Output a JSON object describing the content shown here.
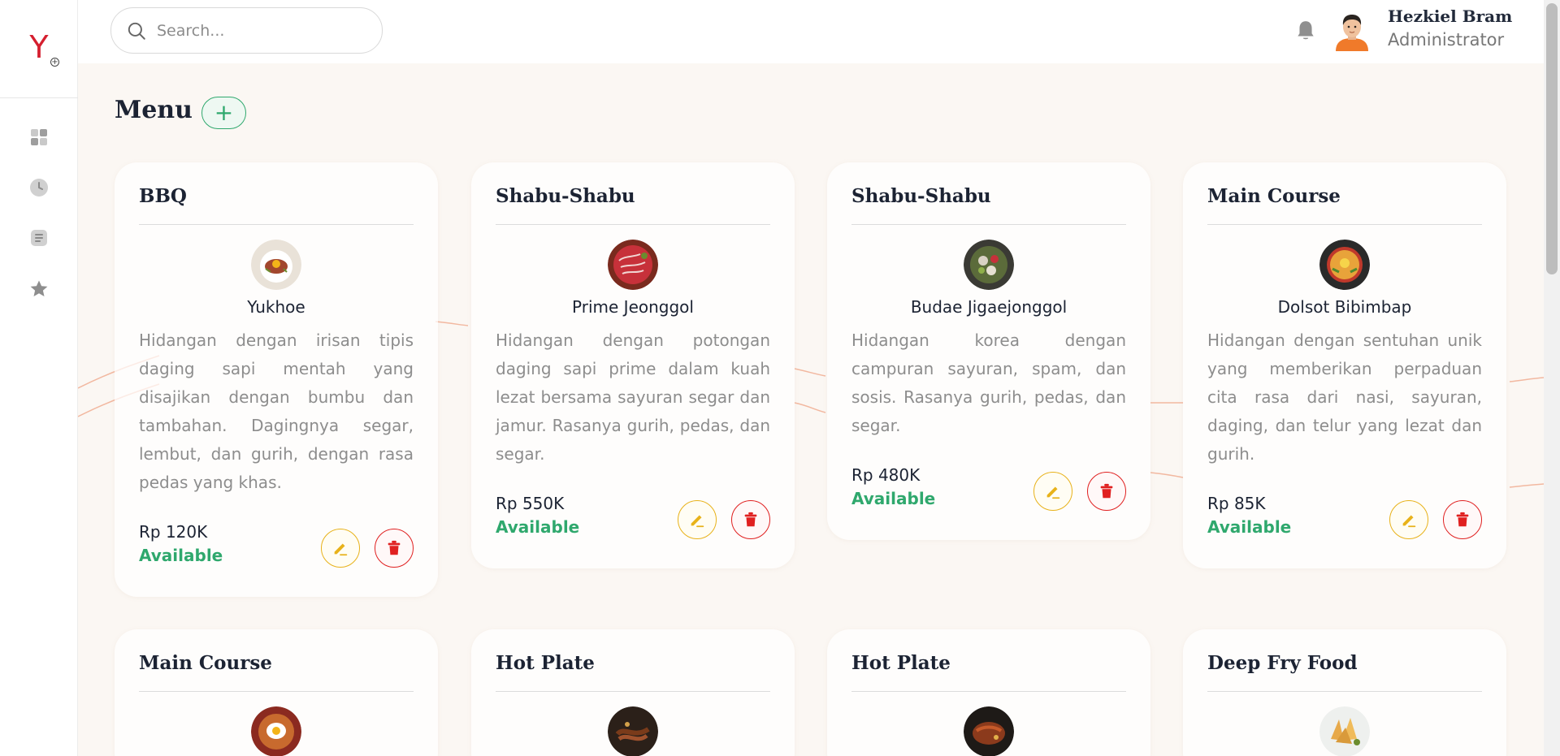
{
  "app": {
    "logo_letter": "Y"
  },
  "search": {
    "placeholder": "Search..."
  },
  "user": {
    "name": "Hezkiel Bram",
    "role": "Administrator"
  },
  "page": {
    "title": "Menu",
    "add_label": "+"
  },
  "colors": {
    "accent_green": "#2fa86d",
    "edit_yellow": "#e8b21a",
    "delete_red": "#e02020",
    "brand_red": "#d51f2f"
  },
  "cards": [
    {
      "category": "BBQ",
      "name": "Yukhoe",
      "description": "Hidangan dengan irisan tipis daging sapi mentah yang disajikan dengan bumbu dan tambahan. Dagingnya segar, lembut, dan gurih, dengan rasa pedas yang khas.",
      "price": "Rp 120K",
      "status": "Available"
    },
    {
      "category": "Shabu-Shabu",
      "name": "Prime Jeonggol",
      "description": "Hidangan dengan potongan daging sapi prime dalam kuah lezat bersama sayuran segar dan jamur. Rasanya gurih, pedas, dan segar.",
      "price": "Rp 550K",
      "status": "Available"
    },
    {
      "category": "Shabu-Shabu",
      "name": "Budae Jigaejonggol",
      "description": "Hidangan korea dengan campuran sayuran, spam, dan sosis. Rasanya gurih, pedas, dan segar.",
      "price": "Rp 480K",
      "status": "Available"
    },
    {
      "category": "Main Course",
      "name": "Dolsot Bibimbap",
      "description": "Hidangan dengan sentuhan unik yang memberikan perpaduan cita rasa dari nasi, sayuran, daging, dan telur yang lezat dan gurih.",
      "price": "Rp 85K",
      "status": "Available"
    },
    {
      "category": "Main Course"
    },
    {
      "category": "Hot Plate"
    },
    {
      "category": "Hot Plate"
    },
    {
      "category": "Deep Fry Food"
    }
  ]
}
